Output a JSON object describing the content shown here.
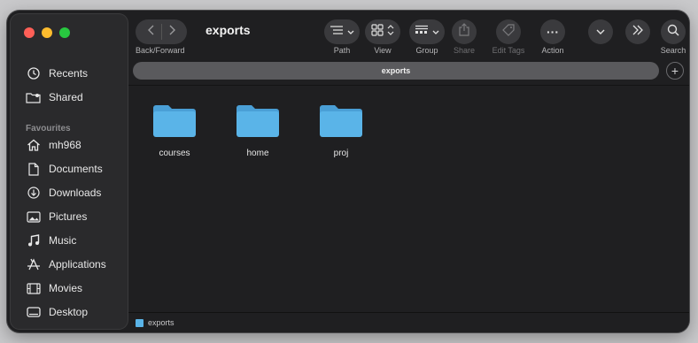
{
  "window": {
    "title": "exports"
  },
  "toolbar": {
    "back_forward_label": "Back/Forward",
    "path_label": "Path",
    "view_label": "View",
    "group_label": "Group",
    "share_label": "Share",
    "edit_tags_label": "Edit Tags",
    "action_label": "Action",
    "search_label": "Search"
  },
  "pathbar": {
    "text": "exports"
  },
  "sidebar": {
    "top_items": [
      {
        "label": "Recents",
        "icon": "clock-icon"
      },
      {
        "label": "Shared",
        "icon": "shared-folder-icon"
      }
    ],
    "favourites_heading": "Favourites",
    "favourites": [
      {
        "label": "mh968",
        "icon": "home-icon"
      },
      {
        "label": "Documents",
        "icon": "document-icon"
      },
      {
        "label": "Downloads",
        "icon": "download-icon"
      },
      {
        "label": "Pictures",
        "icon": "picture-icon"
      },
      {
        "label": "Music",
        "icon": "music-icon"
      },
      {
        "label": "Applications",
        "icon": "applications-icon"
      },
      {
        "label": "Movies",
        "icon": "film-icon"
      },
      {
        "label": "Desktop",
        "icon": "desktop-icon"
      }
    ]
  },
  "folders": [
    {
      "name": "courses"
    },
    {
      "name": "home"
    },
    {
      "name": "proj"
    }
  ],
  "statusbar": {
    "path": "exports"
  },
  "colors": {
    "folder": "#5ab4e8",
    "folder_tab": "#4a9fd6",
    "close": "#ff5f57",
    "minimize": "#febc2e",
    "zoom": "#28c840"
  }
}
